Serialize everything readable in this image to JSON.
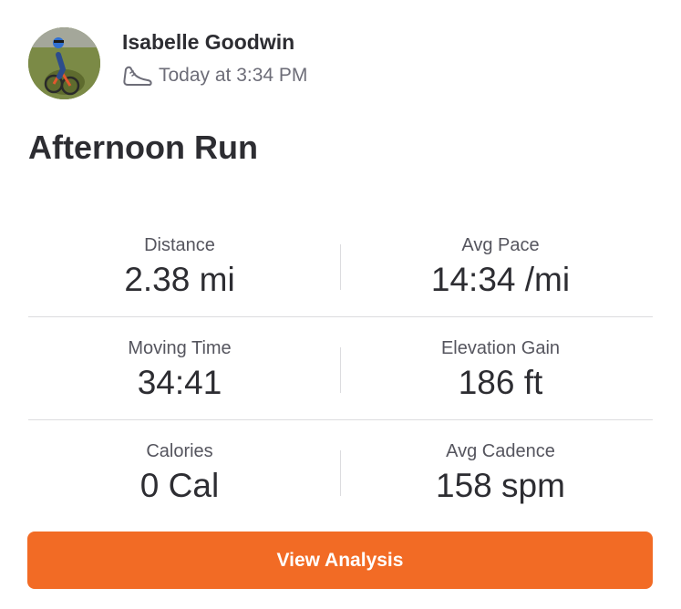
{
  "athlete": {
    "name": "Isabelle Goodwin",
    "avatar_icon": "athlete-avatar-photo"
  },
  "activity": {
    "sport_icon": "running-shoe-icon",
    "timestamp": "Today at 3:34 PM",
    "title": "Afternoon Run"
  },
  "stats": [
    {
      "label": "Distance",
      "value": "2.38 mi"
    },
    {
      "label": "Avg Pace",
      "value": "14:34 /mi"
    },
    {
      "label": "Moving Time",
      "value": "34:41"
    },
    {
      "label": "Elevation Gain",
      "value": "186 ft"
    },
    {
      "label": "Calories",
      "value": "0 Cal"
    },
    {
      "label": "Avg Cadence",
      "value": "158 spm"
    }
  ],
  "actions": {
    "view_analysis_label": "View Analysis"
  },
  "colors": {
    "accent": "#f26b25",
    "text_primary": "#2d2d32",
    "text_secondary": "#6d6d78",
    "divider": "#dcdcdf"
  }
}
